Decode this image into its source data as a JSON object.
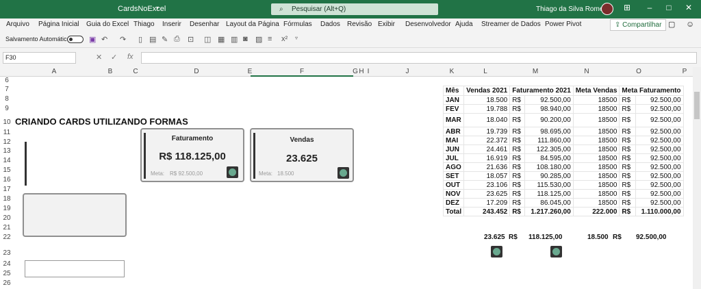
{
  "titlebar": {
    "document": "CardsNoExcel",
    "search_placeholder": "Pesquisar (Alt+Q)",
    "user": "Thiago da Silva Romeiro"
  },
  "menu": [
    "Arquivo",
    "Página Inicial",
    "Guia do Excel",
    "Thiago",
    "Inserir",
    "Desenhar",
    "Layout da Página",
    "Fórmulas",
    "Dados",
    "Revisão",
    "Exibir",
    "Desenvolvedor",
    "Ajuda",
    "Streamer de Dados",
    "Power Pivot"
  ],
  "share_label": "Compartilhar",
  "qat": {
    "autosave_label": "Salvamento Automático"
  },
  "namebox": "F30",
  "columns": [
    "A",
    "B",
    "C",
    "D",
    "E",
    "F",
    "G",
    "H",
    "I",
    "J",
    "K",
    "L",
    "M",
    "N",
    "O",
    "P"
  ],
  "rows": [
    "6",
    "7",
    "8",
    "9",
    "10",
    "11",
    "12",
    "13",
    "14",
    "15",
    "16",
    "17",
    "18",
    "19",
    "20",
    "21",
    "22",
    "23",
    "24",
    "25",
    "26"
  ],
  "sheet": {
    "heading": "CRIANDO CARDS UTILIZANDO FORMAS"
  },
  "cards": {
    "faturamento": {
      "title": "Faturamento",
      "value": "R$ 118.125,00",
      "meta_label": "Meta:",
      "meta_value": "R$ 92.500,00"
    },
    "vendas": {
      "title": "Vendas",
      "value": "23.625",
      "meta_label": "Meta:",
      "meta_value": "18.500"
    }
  },
  "table": {
    "headers": [
      "Mês",
      "Vendas 2021",
      "Faturamento 2021",
      "Meta Vendas",
      "Meta Faturamento"
    ],
    "currency": "R$",
    "rows": [
      [
        "JAN",
        "18.500",
        "92.500,00",
        "18500",
        "92.500,00"
      ],
      [
        "FEV",
        "19.788",
        "98.940,00",
        "18500",
        "92.500,00"
      ],
      [
        "MAR",
        "18.040",
        "90.200,00",
        "18500",
        "92.500,00"
      ],
      [
        "ABR",
        "19.739",
        "98.695,00",
        "18500",
        "92.500,00"
      ],
      [
        "MAI",
        "22.372",
        "111.860,00",
        "18500",
        "92.500,00"
      ],
      [
        "JUN",
        "24.461",
        "122.305,00",
        "18500",
        "92.500,00"
      ],
      [
        "JUL",
        "16.919",
        "84.595,00",
        "18500",
        "92.500,00"
      ],
      [
        "AGO",
        "21.636",
        "108.180,00",
        "18500",
        "92.500,00"
      ],
      [
        "SET",
        "18.057",
        "90.285,00",
        "18500",
        "92.500,00"
      ],
      [
        "OUT",
        "23.106",
        "115.530,00",
        "18500",
        "92.500,00"
      ],
      [
        "NOV",
        "23.625",
        "118.125,00",
        "18500",
        "92.500,00"
      ],
      [
        "DEZ",
        "17.209",
        "86.045,00",
        "18500",
        "92.500,00"
      ]
    ],
    "total": [
      "Total",
      "243.452",
      "1.217.260,00",
      "222.000",
      "1.110.000,00"
    ]
  },
  "summary": {
    "vendas": "23.625",
    "faturamento": "118.125,00",
    "meta_vendas": "18.500",
    "meta_faturamento": "92.500,00"
  },
  "colors": {
    "excel_green": "#217346",
    "status_green": "#69a98f"
  }
}
